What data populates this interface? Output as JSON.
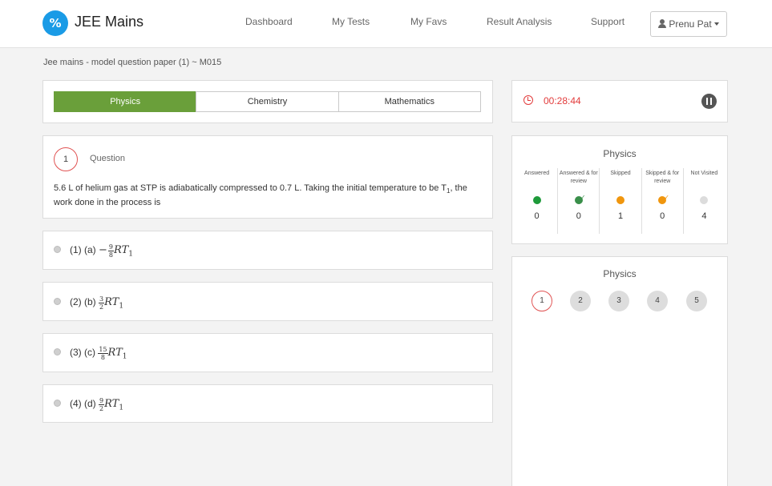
{
  "app": {
    "logo_glyph": "%",
    "title": "JEE Mains"
  },
  "nav": {
    "links": [
      "Dashboard",
      "My Tests",
      "My Favs",
      "Result Analysis",
      "Support"
    ],
    "user": "Prenu Pat"
  },
  "breadcrumb": "Jee mains - model question paper (1) ~ M015",
  "subjects": {
    "tabs": [
      "Physics",
      "Chemistry",
      "Mathematics"
    ],
    "active": "Physics",
    "active_color": "#6a9f3a"
  },
  "question": {
    "number": "1",
    "label": "Question",
    "text_before_subscript": "5.6 L of helium gas at STP is adiabatically compressed to 0.7 L. Taking the initial temperature to be T",
    "text_subscript": "1",
    "text_after_subscript": ", the work done in the process is"
  },
  "options": [
    {
      "prefix": "(1)  (a)",
      "sign": "−",
      "num": "9",
      "den": "8",
      "expr": "RT",
      "sub": "1"
    },
    {
      "prefix": "(2)  (b)",
      "sign": "",
      "num": "3",
      "den": "2",
      "expr": "RT",
      "sub": "1"
    },
    {
      "prefix": "(3)  (c)",
      "sign": "",
      "num": "15",
      "den": "8",
      "expr": "RT",
      "sub": "1"
    },
    {
      "prefix": "(4)  (d)",
      "sign": "",
      "num": "9",
      "den": "2",
      "expr": "RT",
      "sub": "1"
    }
  ],
  "timer": {
    "time": "00:28:44",
    "color": "#e23b3b",
    "icon": "clock-icon"
  },
  "status": {
    "subject": "Physics",
    "items": [
      {
        "label": "Answered",
        "count": "0",
        "color": "#1e9a3a",
        "icon": "dot"
      },
      {
        "label": "Answered & for review",
        "count": "0",
        "color": "#3a8f4a",
        "icon": "check-dot"
      },
      {
        "label": "Skipped",
        "count": "1",
        "color": "#f0960e",
        "icon": "dot"
      },
      {
        "label": "Skipped & for review",
        "count": "0",
        "color": "#f0960e",
        "icon": "check-dot"
      },
      {
        "label": "Not Visited",
        "count": "4",
        "color": "#dcdcdc",
        "icon": "dot"
      }
    ]
  },
  "palette": {
    "subject": "Physics",
    "numbers": [
      "1",
      "2",
      "3",
      "4",
      "5"
    ],
    "current": "1"
  }
}
